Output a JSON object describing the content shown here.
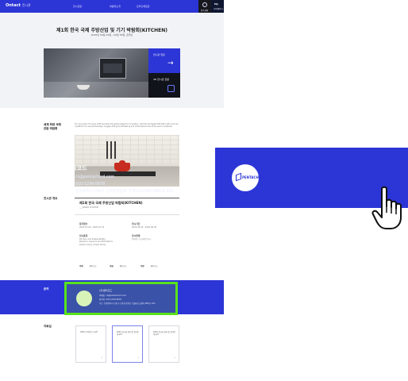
{
  "header": {
    "logo": "Ontact",
    "logo_sub": "전시관",
    "nav": [
      "전시관람",
      "박람회소개",
      "온라인체험관"
    ],
    "btn1_label": "접속현황",
    "btn2_label": "My",
    "btn2_sub": "나의페이지"
  },
  "hero": {
    "title": "제1회 한국 국제 주방산업 및 기기 박람회(KITCHEN)",
    "date": "2020년 09월 24일 - 09월 30일, 온라인",
    "blue_tile": "전시관 입장",
    "dark_tile": "3D 전시관 관람"
  },
  "sections": {
    "intro_label_line1": "세계 최대 국제",
    "intro_label_line2": "관람 박람회",
    "intro_text": "For more than 70 years, IKTP has been the global stage for innovation. Visit the all-digital IKTP 2021 with us to be a platform to new partnerships, engage with groundbreaking and influential brands of the world industries.",
    "info_label": "전시관 개요",
    "contact_label": "문의",
    "reference_label": "자료실"
  },
  "info": {
    "title": "제1회 한국 국제 주방산업 박람회(KITCHEN)",
    "subtitle": "___KOREA KITCHEN",
    "col1_key1": "참가접수",
    "col1_val1": "2020.07.20 - 2020.07.31",
    "col2_key1": "전시기간",
    "col2_val1": "2020.09.24 - 2020.09.30",
    "col1_key2": "전시품목",
    "col1_val2": "Kitchen and Sustainability, Robotics, Sensors and Biometrics, Smart Living, Smart Home",
    "col2_key2": "전시형태",
    "col2_val2": "온라인 / 오프라인 동시",
    "foot1_k": "주최",
    "foot1_v": "펜타코드",
    "foot2_k": "후원",
    "foot2_v": "펜타코드",
    "foot3_k": "주관",
    "foot3_v": "펜타코드"
  },
  "contact_small": {
    "name": "(주)펜타코드",
    "email_k": "이메일",
    "email_v": "cs@pentachord.com",
    "phone_k": "연락처",
    "phone_v": "010-1234-5678",
    "addr_k": "주소",
    "addr_v": "인천광역시 남동구 선수촌공원로 구월테크노밸리 ABC호 101"
  },
  "references": [
    "2020 조직연구소.pdf",
    "2020 전시회 개요 및 참가안내.pdf",
    "2020 전시회 개요 및 참가안내.pdf",
    "2020 전시회 개요 및 참가안내.pdf"
  ],
  "zoom_card": {
    "brand": "PENTACHORD",
    "name": "(주)펜타코드",
    "email_key": "이메일",
    "email_value": "cs@pentachord.com",
    "phone_key": "연락처",
    "phone_value": "010-1234-5678",
    "addr_key": "주소",
    "addr_value": "인천광역시 남동구 선수촌공원로 구월테크노밸리 ABC호 101"
  },
  "colors": {
    "primary": "#2c35d6",
    "highlight": "#59e21a"
  }
}
